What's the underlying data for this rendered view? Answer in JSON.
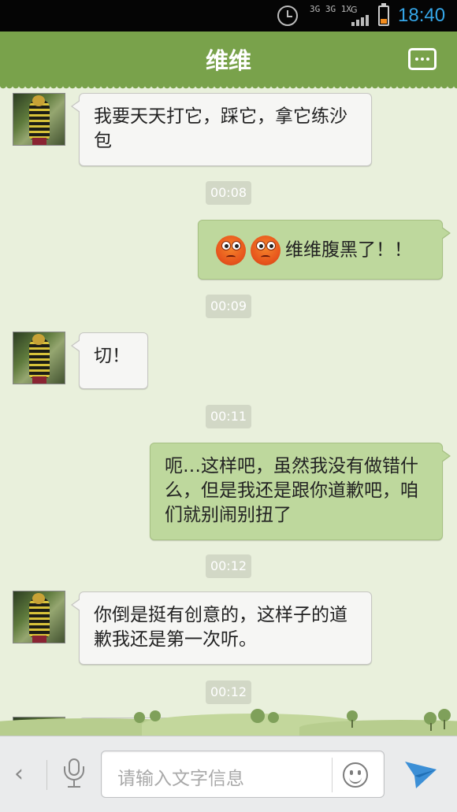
{
  "status_bar": {
    "time": "18:40",
    "network": "3G 3G 1X",
    "network_alt": "G",
    "icons": [
      "alarm-icon",
      "signal-icon",
      "battery-icon"
    ]
  },
  "header": {
    "title": "维维",
    "menu_icon": "more-dots-icon"
  },
  "messages": [
    {
      "side": "left",
      "text": "我要天天打它，踩它，拿它练沙包"
    },
    {
      "type": "timestamp",
      "text": "00:08"
    },
    {
      "side": "right",
      "emoji_count": 2,
      "emoji": "angry-face-icon",
      "text": "维维腹黑了！！"
    },
    {
      "type": "timestamp",
      "text": "00:09"
    },
    {
      "side": "left",
      "text": "切！"
    },
    {
      "type": "timestamp",
      "text": "00:11"
    },
    {
      "side": "right",
      "text": "呃…这样吧，虽然我没有做错什么，但是我还是跟你道歉吧，咱们就别闹别扭了"
    },
    {
      "type": "timestamp",
      "text": "00:12"
    },
    {
      "side": "left",
      "text": "你倒是挺有创意的，这样子的道歉我还是第一次听。"
    },
    {
      "type": "timestamp",
      "text": "00:12"
    }
  ],
  "input_bar": {
    "placeholder": "请输入文字信息",
    "icons": [
      "back-chevron-icon",
      "microphone-icon",
      "smiley-icon",
      "send-icon"
    ]
  },
  "colors": {
    "header_green": "#79a24b",
    "chat_background": "#e9f0dc",
    "outgoing_bubble": "#bed89d",
    "incoming_bubble": "#f6f6f4",
    "time_blue": "#35a6e8"
  }
}
